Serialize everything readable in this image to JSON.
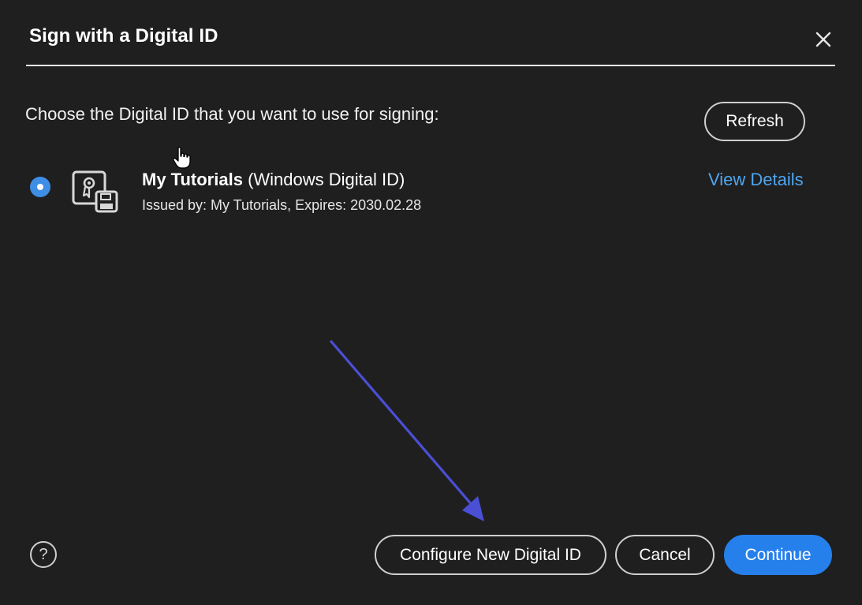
{
  "dialog": {
    "title": "Sign with a Digital ID",
    "prompt": "Choose the Digital ID that you want to use for signing:",
    "refresh_label": "Refresh"
  },
  "digital_id": {
    "name_bold": "My Tutorials",
    "name_rest": " (Windows Digital ID)",
    "issued_by": "Issued by: My Tutorials, Expires: 2030.02.28",
    "view_details_label": "View Details",
    "selected": true
  },
  "footer": {
    "help_label": "?",
    "configure_label": "Configure New Digital ID",
    "cancel_label": "Cancel",
    "continue_label": "Continue"
  },
  "colors": {
    "background": "#1f1f1f",
    "accent_blue": "#2680eb",
    "link_blue": "#4fa6f0",
    "annotation_arrow": "#4a4fd6"
  },
  "icons": [
    "close-icon",
    "radio-selected-icon",
    "certificate-icon",
    "hand-cursor-icon",
    "help-icon",
    "annotation-arrow"
  ]
}
